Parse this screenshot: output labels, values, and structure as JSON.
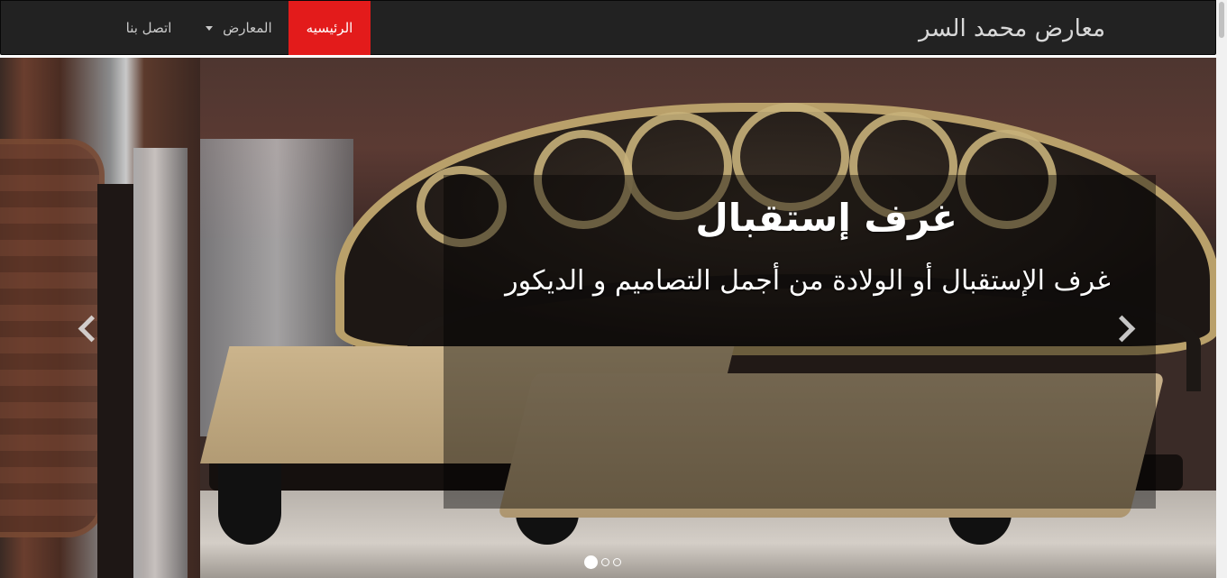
{
  "navbar": {
    "brand": "معارض محمد السر",
    "items": [
      {
        "label": "الرئيسيه",
        "active": true
      },
      {
        "label": "المعارض",
        "dropdown": true
      },
      {
        "label": "اتصل بنا"
      }
    ],
    "active_color": "#e31b1b",
    "background": "#222222"
  },
  "carousel": {
    "slide": {
      "title": "غرف إستقبال",
      "text": "غرف الإستقبال أو الولادة من أجمل التصاميم و الديكور"
    },
    "controls": {
      "prev_icon": "chevron-left-icon",
      "next_icon": "chevron-right-icon"
    },
    "indicators": {
      "count": 3,
      "active_index": 0
    }
  }
}
